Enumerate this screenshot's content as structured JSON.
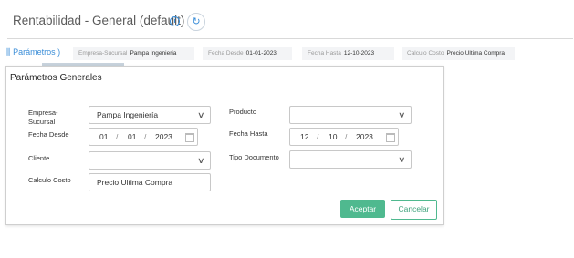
{
  "header": {
    "title": "Rentabilidad - General (default)",
    "info_icon": "info-icon",
    "refresh_icon": "refresh-icon"
  },
  "filters_bar": {
    "params_label": "Parámetros",
    "params_icon": "sliders-icon",
    "chips": [
      {
        "label": "Empresa-Sucursal",
        "value": "Pampa Ingenieria"
      },
      {
        "label": "Fecha Desde",
        "value": "01-01-2023"
      },
      {
        "label": "Fecha Hasta",
        "value": "12-10-2023"
      },
      {
        "label": "Calculo Costo",
        "value": "Precio Ultima Compra"
      }
    ]
  },
  "modal": {
    "title": "Parámetros Generales",
    "empresa": {
      "label_line1": "Empresa-",
      "label_line2": "Sucursal",
      "value": "Pampa Ingeniería"
    },
    "producto": {
      "label": "Producto",
      "value": ""
    },
    "fecha_desde": {
      "label": "Fecha Desde",
      "day": "01",
      "month": "01",
      "year": "2023"
    },
    "fecha_hasta": {
      "label": "Fecha Hasta",
      "day": "12",
      "month": "10",
      "year": "2023"
    },
    "cliente": {
      "label": "Cliente",
      "value": ""
    },
    "tipo_documento": {
      "label": "Tipo Documento",
      "value": ""
    },
    "calculo_costo": {
      "label": "Calculo Costo",
      "value": "Precio Ultima Compra"
    },
    "accept_label": "Aceptar",
    "cancel_label": "Cancelar"
  },
  "colors": {
    "accent_blue": "#3b8ed8",
    "accept_green": "#4fb98f"
  }
}
